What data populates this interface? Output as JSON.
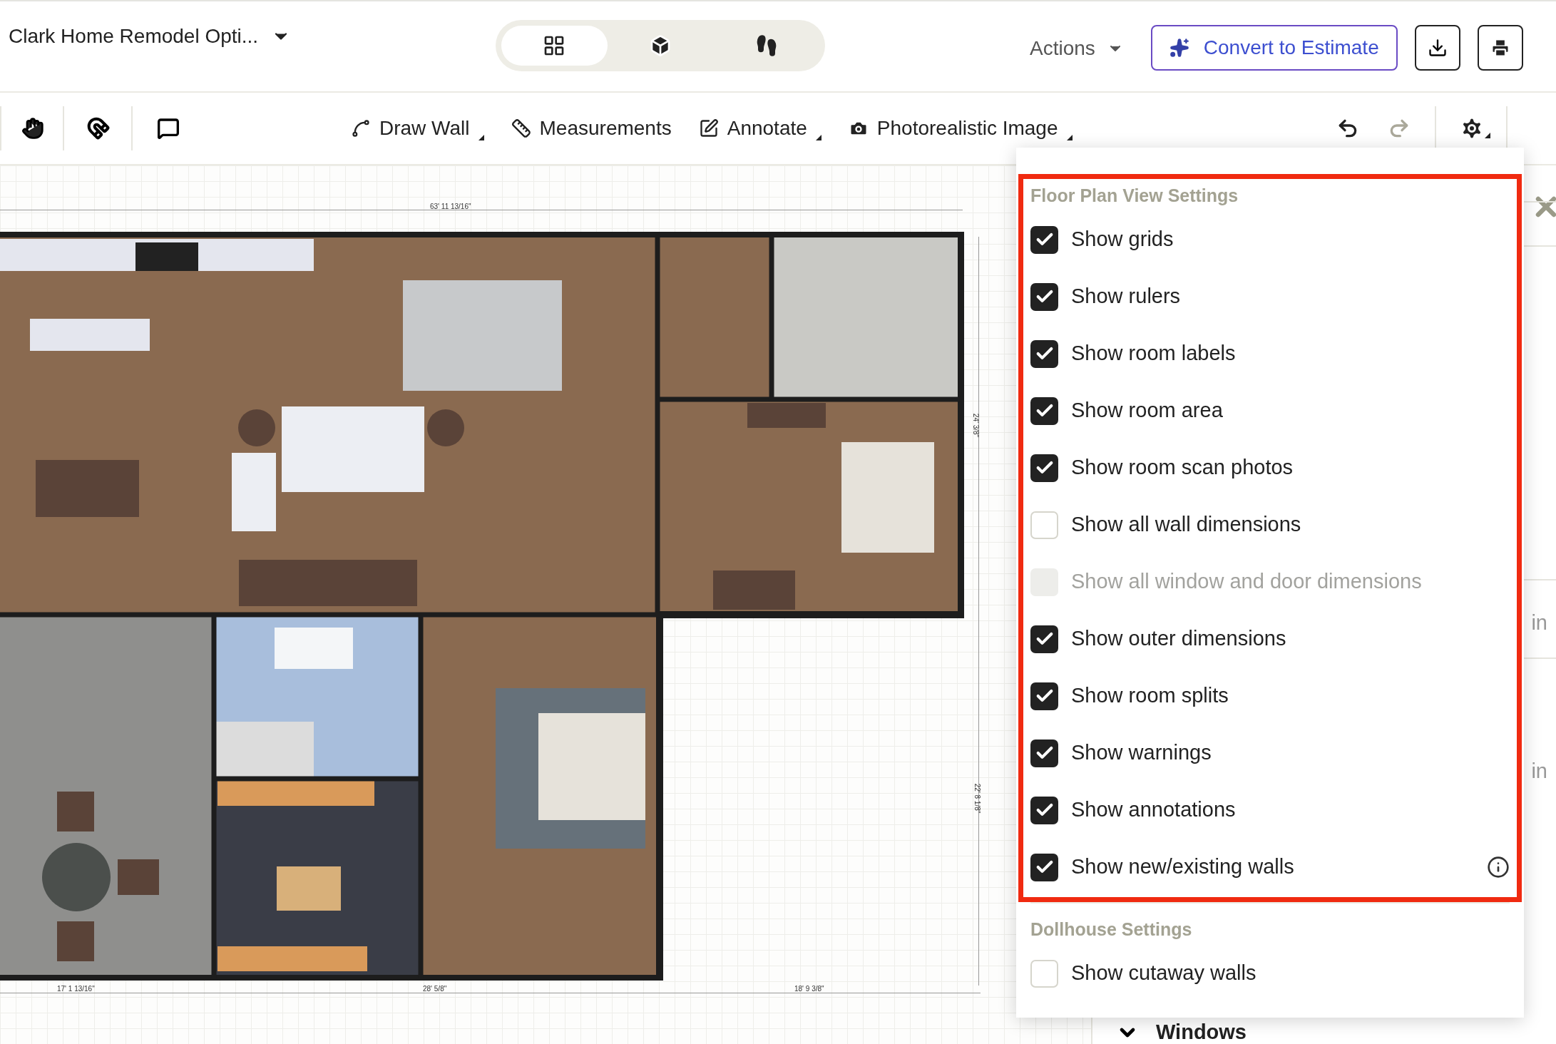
{
  "header": {
    "title": "Clark Home Remodel Opti...",
    "view_modes": [
      {
        "kind": "floorplan",
        "selected": true
      },
      {
        "kind": "dollhouse",
        "selected": false
      },
      {
        "kind": "walkthrough",
        "selected": false
      }
    ],
    "actions": "Actions",
    "convert": "Convert to Estimate"
  },
  "toolbar": {
    "tools": [
      {
        "kind": "wall",
        "label": "Draw Wall",
        "dropdown": true
      },
      {
        "kind": "measure",
        "label": "Measurements",
        "dropdown": false
      },
      {
        "kind": "annotate",
        "label": "Annotate",
        "dropdown": true
      },
      {
        "kind": "camera",
        "label": "Photorealistic Image",
        "dropdown": true
      }
    ],
    "undo": {
      "disabled": false
    },
    "redo": {
      "disabled": true
    }
  },
  "dimensions": {
    "top": "63' 11 13/16\"",
    "right": [
      "24' 3/8\"",
      "22' 8 1/8\""
    ],
    "bottom": [
      "17' 1 13/16\"",
      "28' 5/8\"",
      "18' 9 3/8\""
    ]
  },
  "settings_menu": {
    "sections": [
      {
        "title": "Floor Plan View Settings",
        "highlighted": true,
        "items": [
          {
            "label": "Show grids",
            "checked": true,
            "disabled": false,
            "info": false
          },
          {
            "label": "Show rulers",
            "checked": true,
            "disabled": false,
            "info": false
          },
          {
            "label": "Show room labels",
            "checked": true,
            "disabled": false,
            "info": false
          },
          {
            "label": "Show room area",
            "checked": true,
            "disabled": false,
            "info": false
          },
          {
            "label": "Show room scan photos",
            "checked": true,
            "disabled": false,
            "info": false
          },
          {
            "label": "Show all wall dimensions",
            "checked": false,
            "disabled": false,
            "info": false
          },
          {
            "label": "Show all window and door dimensions",
            "checked": false,
            "disabled": true,
            "info": false
          },
          {
            "label": "Show outer dimensions",
            "checked": true,
            "disabled": false,
            "info": false
          },
          {
            "label": "Show room splits",
            "checked": true,
            "disabled": false,
            "info": false
          },
          {
            "label": "Show warnings",
            "checked": true,
            "disabled": false,
            "info": false
          },
          {
            "label": "Show annotations",
            "checked": true,
            "disabled": false,
            "info": false
          },
          {
            "label": "Show new/existing walls",
            "checked": true,
            "disabled": false,
            "info": true
          }
        ]
      },
      {
        "title": "Dollhouse Settings",
        "highlighted": false,
        "items": [
          {
            "label": "Show cutaway walls",
            "checked": false,
            "disabled": false,
            "info": false
          }
        ]
      }
    ]
  },
  "side_panel": {
    "units": [
      "in",
      "in"
    ],
    "section": "Windows"
  }
}
